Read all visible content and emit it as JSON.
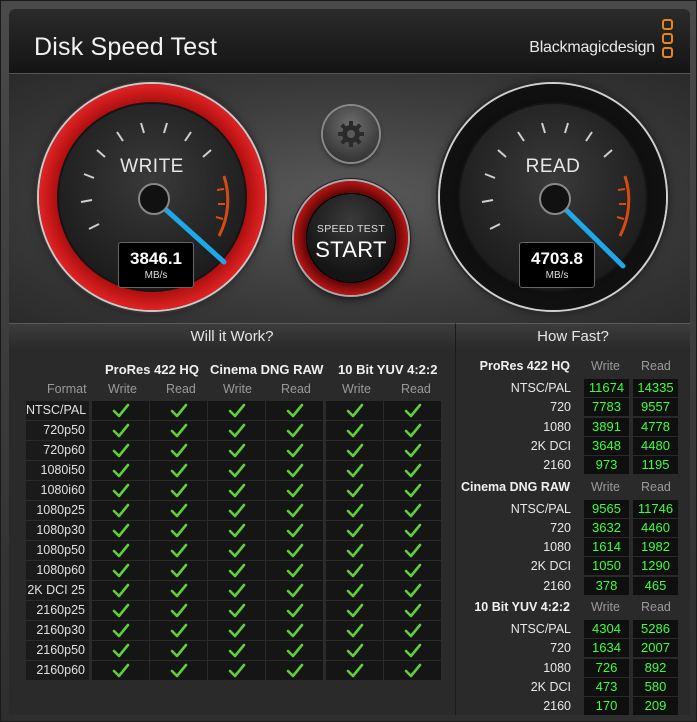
{
  "app": {
    "title": "Disk Speed Test",
    "brand": "Blackmagicdesign"
  },
  "gauges": {
    "write": {
      "label": "WRITE",
      "value": "3846.1",
      "unit": "MB/s"
    },
    "read": {
      "label": "READ",
      "value": "4703.8",
      "unit": "MB/s"
    }
  },
  "start_button": {
    "top_label": "SPEED TEST",
    "label": "START"
  },
  "will_it_work": {
    "title": "Will it Work?",
    "format_label": "Format",
    "codecs": [
      "ProRes 422 HQ",
      "Cinema DNG RAW",
      "10 Bit YUV 4:2:2"
    ],
    "write_label": "Write",
    "read_label": "Read",
    "formats": [
      "NTSC/PAL",
      "720p50",
      "720p60",
      "1080i50",
      "1080i60",
      "1080p25",
      "1080p30",
      "1080p50",
      "1080p60",
      "2K DCI 25",
      "2160p25",
      "2160p30",
      "2160p50",
      "2160p60"
    ],
    "status": "all-supported"
  },
  "how_fast": {
    "title": "How Fast?",
    "write_label": "Write",
    "read_label": "Read",
    "sections": [
      {
        "name": "ProRes 422 HQ",
        "rows": [
          {
            "format": "NTSC/PAL",
            "write": "11674",
            "read": "14335"
          },
          {
            "format": "720",
            "write": "7783",
            "read": "9557"
          },
          {
            "format": "1080",
            "write": "3891",
            "read": "4778"
          },
          {
            "format": "2K DCI",
            "write": "3648",
            "read": "4480"
          },
          {
            "format": "2160",
            "write": "973",
            "read": "1195"
          }
        ]
      },
      {
        "name": "Cinema DNG RAW",
        "rows": [
          {
            "format": "NTSC/PAL",
            "write": "9565",
            "read": "11746"
          },
          {
            "format": "720",
            "write": "3632",
            "read": "4460"
          },
          {
            "format": "1080",
            "write": "1614",
            "read": "1982"
          },
          {
            "format": "2K DCI",
            "write": "1050",
            "read": "1290"
          },
          {
            "format": "2160",
            "write": "378",
            "read": "465"
          }
        ]
      },
      {
        "name": "10 Bit YUV 4:2:2",
        "rows": [
          {
            "format": "NTSC/PAL",
            "write": "4304",
            "read": "5286"
          },
          {
            "format": "720",
            "write": "1634",
            "read": "2007"
          },
          {
            "format": "1080",
            "write": "726",
            "read": "892"
          },
          {
            "format": "2K DCI",
            "write": "473",
            "read": "580"
          },
          {
            "format": "2160",
            "write": "170",
            "read": "209"
          }
        ]
      }
    ]
  },
  "colors": {
    "accent_red": "#c21515",
    "needle": "#1fa8e8",
    "value_green": "#3dff3d",
    "brand_orange": "#e3891b",
    "check_green": "#5fd03a"
  }
}
